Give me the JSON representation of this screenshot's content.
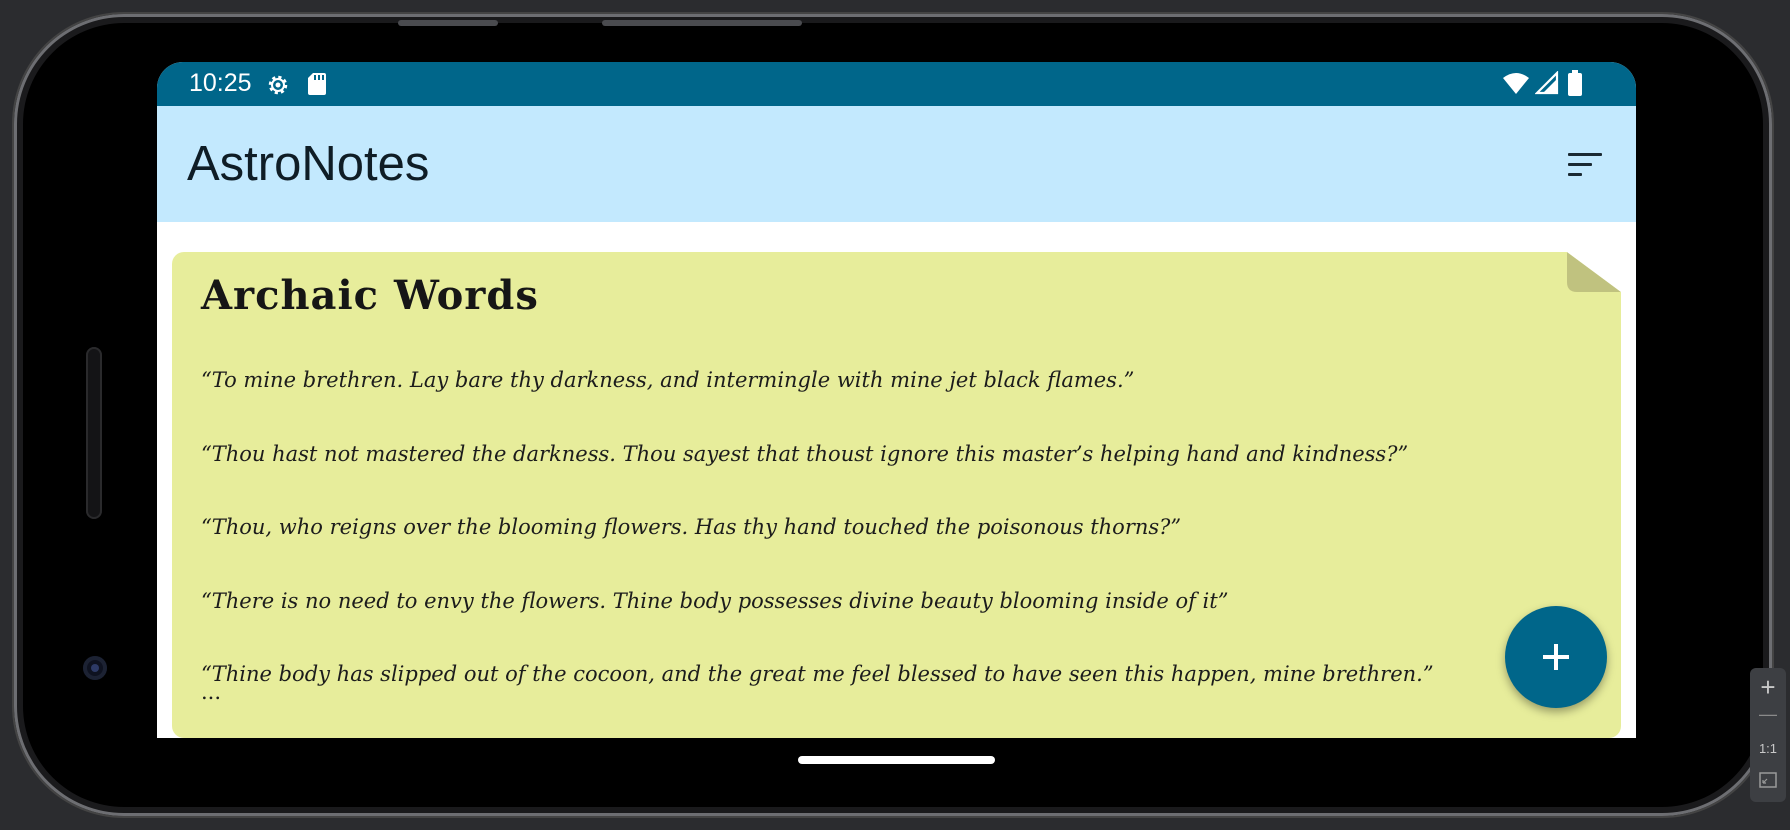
{
  "status_bar": {
    "time": "10:25",
    "left_icons": [
      "settings-gear-icon",
      "sd-card-icon"
    ],
    "right_icons": [
      "wifi-icon",
      "cell-signal-icon",
      "battery-icon"
    ],
    "color": "#00668a"
  },
  "app_bar": {
    "title": "AstroNotes",
    "sort_icon": "sort-icon",
    "color": "#c3e9fe"
  },
  "note": {
    "title": "Archaic Words",
    "lines": [
      "“To mine brethren. Lay bare thy darkness, and intermingle with mine jet black flames.”",
      "“Thou hast not mastered the darkness. Thou sayest that thoust ignore this master’s helping hand and kindness?”",
      "“Thou, who reigns over the blooming flowers. Has thy hand touched the poisonous thorns?”",
      "“There is no need to envy the flowers. Thine body possesses divine beauty blooming inside of it”",
      "“Thine body has slipped out of the cocoon, and the great me feel blessed to have seen this happen, mine brethren.”"
    ],
    "ellipsis": "...",
    "color": "#e7ed9b"
  },
  "fab": {
    "icon": "plus-icon",
    "color": "#00668a"
  },
  "emulator_zoom": {
    "zoom_in": "+",
    "zoom_out": "—",
    "actual_size": "1:1",
    "fit_icon": "fit-screen-icon"
  }
}
